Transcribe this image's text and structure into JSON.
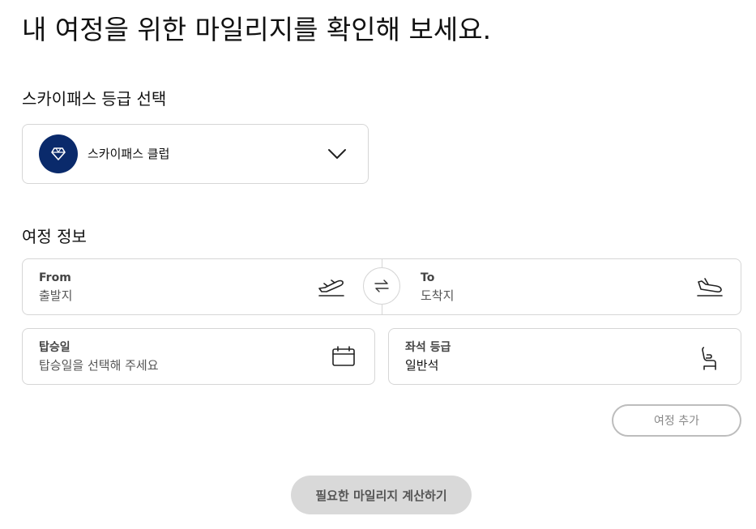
{
  "page": {
    "title": "내 여정을 위한 마일리지를 확인해 보세요."
  },
  "tier": {
    "section_label": "스카이패스 등급 선택",
    "selected": "스카이패스 클럽",
    "icon": "diamond-icon",
    "badge_color": "#0a2a6b"
  },
  "journey": {
    "section_label": "여정 정보",
    "from_label": "From",
    "from_placeholder": "출발지",
    "to_label": "To",
    "to_placeholder": "도착지",
    "date_label": "탑승일",
    "date_placeholder": "탑승일을 선택해 주세요",
    "class_label": "좌석 등급",
    "class_value": "일반석"
  },
  "actions": {
    "add_journey": "여정 추가",
    "calculate": "필요한 마일리지 계산하기"
  }
}
